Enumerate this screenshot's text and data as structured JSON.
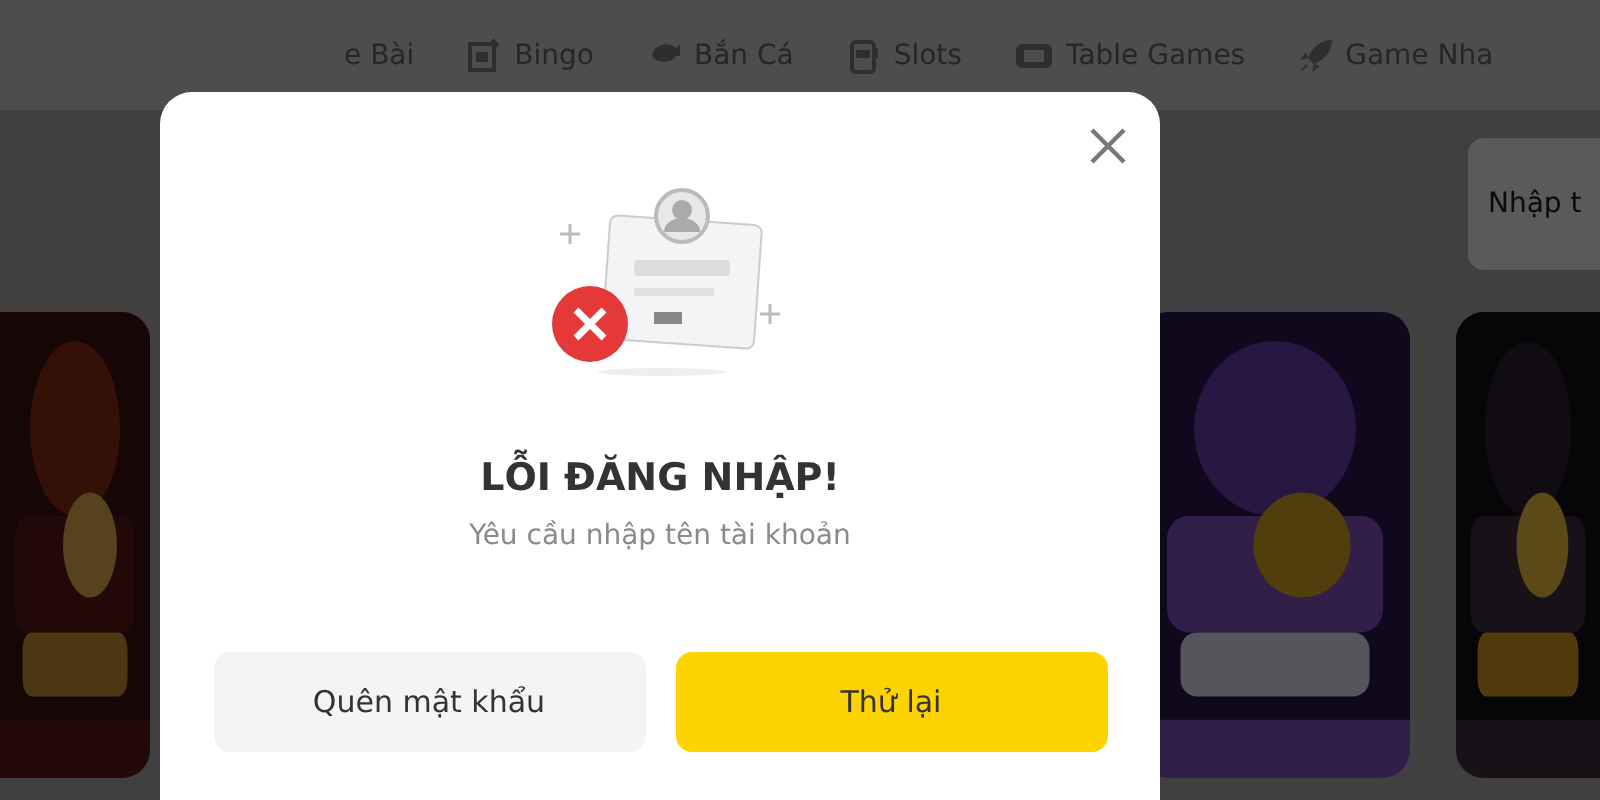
{
  "nav": {
    "items": [
      {
        "label": "e Bài"
      },
      {
        "label": "Bingo"
      },
      {
        "label": "Bắn Cá"
      },
      {
        "label": "Slots"
      },
      {
        "label": "Table Games"
      },
      {
        "label": "Game Nha"
      }
    ]
  },
  "search": {
    "placeholder": "Nhập t"
  },
  "dialog": {
    "title": "LỖI ĐĂNG NHẬP!",
    "message": "Yêu cầu nhập tên tài khoản",
    "buttons": [
      {
        "label": "Quên mật khẩu",
        "kind": "secondary"
      },
      {
        "label": "Thử lại",
        "kind": "primary"
      }
    ]
  }
}
